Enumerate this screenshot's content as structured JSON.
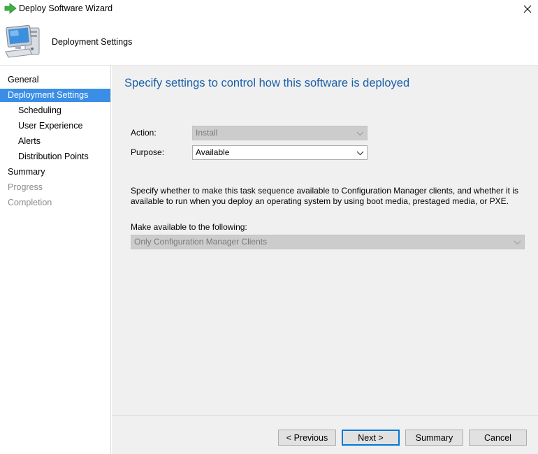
{
  "window": {
    "title": "Deploy Software Wizard",
    "close_glyph": "✕"
  },
  "header": {
    "title": "Deployment Settings",
    "icon": "computer-icon"
  },
  "sidebar": {
    "items": [
      {
        "label": "General",
        "state": "normal"
      },
      {
        "label": "Deployment Settings",
        "state": "selected"
      },
      {
        "label": "Scheduling",
        "state": "normal"
      },
      {
        "label": "User Experience",
        "state": "normal"
      },
      {
        "label": "Alerts",
        "state": "normal"
      },
      {
        "label": "Distribution Points",
        "state": "normal"
      },
      {
        "label": "Summary",
        "state": "normal"
      },
      {
        "label": "Progress",
        "state": "disabled"
      },
      {
        "label": "Completion",
        "state": "disabled"
      }
    ]
  },
  "main": {
    "heading": "Specify settings to control how this software is deployed",
    "action": {
      "label": "Action:",
      "value": "Install",
      "enabled": false
    },
    "purpose": {
      "label": "Purpose:",
      "value": "Available",
      "enabled": true
    },
    "description": "Specify whether to make this task sequence available to Configuration Manager clients, and whether it is available to run when you deploy an operating system by using boot media, prestaged media, or PXE.",
    "make_available": {
      "label": "Make available to the following:",
      "value": "Only Configuration Manager Clients",
      "enabled": false
    }
  },
  "footer": {
    "previous_label": "< Previous",
    "next_label": "Next >",
    "summary_label": "Summary",
    "cancel_label": "Cancel"
  },
  "colors": {
    "accent": "#3a8ee6",
    "heading": "#1a5fa8",
    "panel": "#f0f0f0",
    "arrow_icon": "#3cb043"
  }
}
